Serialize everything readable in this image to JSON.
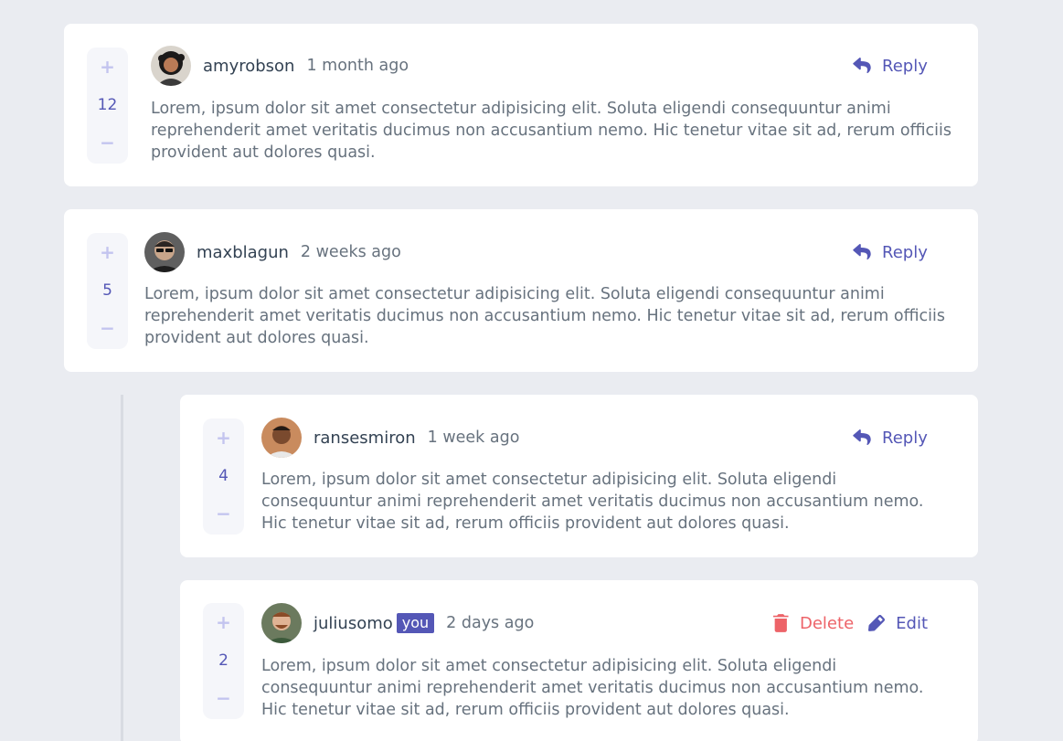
{
  "colors": {
    "background": "#eaecf1",
    "accent": "#5457b6",
    "accent_light": "#c3c4ef",
    "danger": "#ed6368",
    "text_dark": "#334253",
    "text_muted": "#67727e"
  },
  "comments": [
    {
      "username": "amyrobson",
      "time": "1 month ago",
      "score": "12",
      "text": "Lorem, ipsum dolor sit amet consectetur adipisicing elit. Soluta eligendi consequuntur animi reprehenderit amet veritatis ducimus non accusantium nemo. Hic tenetur vitae sit ad, rerum officiis provident aut dolores quasi.",
      "reply_label": "Reply"
    },
    {
      "username": "maxblagun",
      "time": "2 weeks ago",
      "score": "5",
      "text": "Lorem, ipsum dolor sit amet consectetur adipisicing elit. Soluta eligendi consequuntur animi reprehenderit amet veritatis ducimus non accusantium nemo. Hic tenetur vitae sit ad, rerum officiis provident aut dolores quasi.",
      "reply_label": "Reply"
    },
    {
      "username": "ransesmiron",
      "time": "1 week ago",
      "score": "4",
      "text": "Lorem, ipsum dolor sit amet consectetur adipisicing elit. Soluta eligendi consequuntur animi reprehenderit amet veritatis ducimus non accusantium nemo. Hic tenetur vitae sit ad, rerum officiis provident aut dolores quasi.",
      "reply_label": "Reply"
    },
    {
      "username": "juliusomo",
      "you_badge": "you",
      "time": "2 days ago",
      "score": "2",
      "text": "Lorem, ipsum dolor sit amet consectetur adipisicing elit. Soluta eligendi consequuntur animi reprehenderit amet veritatis ducimus non accusantium nemo. Hic tenetur vitae sit ad, rerum officiis provident aut dolores quasi.",
      "delete_label": "Delete",
      "edit_label": "Edit"
    }
  ],
  "vote": {
    "plus": "+",
    "minus": "−"
  },
  "icons": {
    "reply": "reply-arrow-icon",
    "delete": "trash-icon",
    "edit": "pencil-icon",
    "upvote": "plus-icon",
    "downvote": "minus-icon"
  }
}
